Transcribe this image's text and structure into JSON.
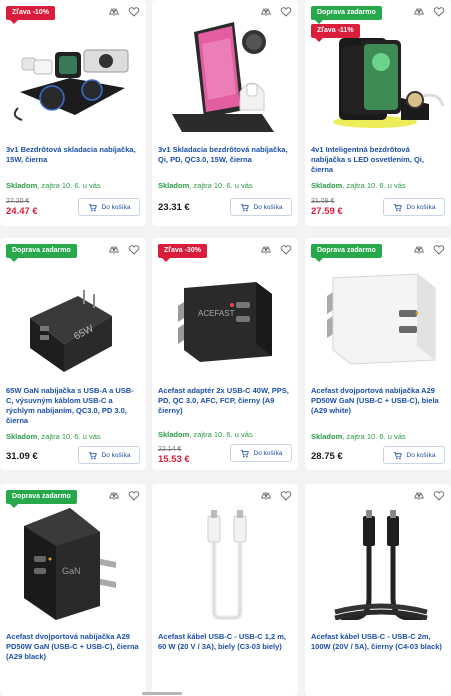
{
  "products": [
    {
      "badges": [
        {
          "type": "sale",
          "text": "Zľava -10%"
        }
      ],
      "title": "3v1 Bezdrôtová skladacia nabíjačka, 15W, čierna",
      "stock": "Skladom",
      "delivery": ", zajtra 10. 6. u vás",
      "old_price": "27.20 €",
      "price": "24.47 €",
      "cart_label": "Do košíka"
    },
    {
      "badges": [],
      "title": "3v1 Skladacia bezdrôtová nabíjačka, Qi, PD, QC3.0, 15W, čierna",
      "stock": "Skladom",
      "delivery": ", zajtra 10. 6. u vás",
      "old_price": "",
      "price": "23.31 €",
      "cart_label": "Do košíka"
    },
    {
      "badges": [
        {
          "type": "ship",
          "text": "Doprava zadarmo"
        },
        {
          "type": "sale",
          "text": "Zľava -11%"
        }
      ],
      "title": "4v1 Inteligentná bezdrôtová nabíjačka s LED osvetlením, Qi, čierna",
      "stock": "Skladom",
      "delivery": ", zajtra 10. 6. u vás",
      "old_price": "31.09 €",
      "price": "27.59 €",
      "cart_label": "Do košíka"
    },
    {
      "badges": [
        {
          "type": "ship",
          "text": "Doprava zadarmo"
        }
      ],
      "title": "65W GaN nabíjačka s USB-A a USB-C, výsuvným káblom USB-C a rýchlym nabíjaním, QC3.0, PD 3.0, čierna",
      "stock": "Skladom",
      "delivery": ", zajtra 10. 6. u vás",
      "old_price": "",
      "price": "31.09 €",
      "cart_label": "Do košíka"
    },
    {
      "badges": [
        {
          "type": "sale",
          "text": "Zľava -30%"
        }
      ],
      "title": "Acefast adaptér 2x USB-C 40W, PPS, PD, QC 3.0, AFC, FCP, čierny (A9 čierny)",
      "stock": "Skladom",
      "delivery": ", zajtra 10. 6. u vás",
      "old_price": "22.14 €",
      "price": "15.53 €",
      "cart_label": "Do košíka"
    },
    {
      "badges": [
        {
          "type": "ship",
          "text": "Doprava zadarmo"
        }
      ],
      "title": "Acefast dvojportová nabíjačka A29 PD50W GaN (USB-C + USB-C), biela (A29 white)",
      "stock": "Skladom",
      "delivery": ", zajtra 10. 6. u vás",
      "old_price": "",
      "price": "28.75 €",
      "cart_label": "Do košíka"
    },
    {
      "badges": [
        {
          "type": "ship",
          "text": "Doprava zadarmo"
        }
      ],
      "title": "Acefast dvojportová nabíjačka A29 PD50W GaN (USB-C + USB-C), čierna (A29 black)",
      "stock": "",
      "delivery": "",
      "old_price": "",
      "price": "",
      "cart_label": ""
    },
    {
      "badges": [],
      "title": "Acefast kábel USB-C - USB-C 1,2 m, 60 W (20 V / 3A), biely (C3-03 biely)",
      "stock": "",
      "delivery": "",
      "old_price": "",
      "price": "",
      "cart_label": ""
    },
    {
      "badges": [],
      "title": "Acefast kábel USB-C - USB-C 2m, 100W (20V / 5A), čierny (C4-03 black)",
      "stock": "",
      "delivery": "",
      "old_price": "",
      "price": "",
      "cart_label": ""
    }
  ],
  "icons": {
    "compare": "compare-icon",
    "wishlist": "heart-icon",
    "cart": "cart-icon"
  },
  "colors": {
    "link": "#1a4fa8",
    "stock": "#2a9a45",
    "sale": "#d91d3b",
    "ship": "#27a84a"
  }
}
